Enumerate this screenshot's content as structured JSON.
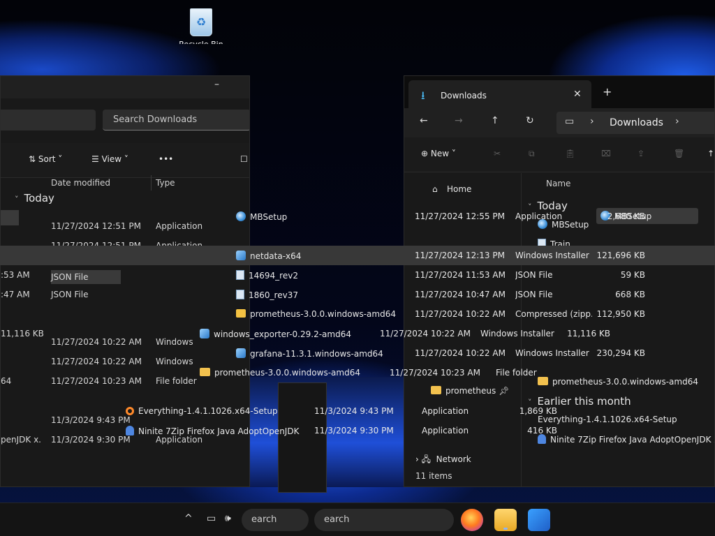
{
  "desktop": {
    "recycle_bin_label": "Recycle Bin"
  },
  "left_window": {
    "search_placeholder": "Search Downloads",
    "toolbar": {
      "sort": "Sort",
      "view": "View",
      "more": "•••"
    },
    "columns": {
      "date": "Date modified",
      "type": "Type"
    },
    "group_today": "Today",
    "rows": [
      {
        "date": "11/27/2024 12:51 PM",
        "type": "Application"
      },
      {
        "date": "11/27/2024 12:51 PM",
        "type": "Application"
      },
      {
        "date": "11/27/2024 12:13 PM",
        "type": "Windows Insta"
      },
      {
        "date": "11/27/2024 11:53 AM",
        "type": "JSON File"
      },
      {
        "date": "11/27/2024 10:47 AM",
        "type": "JSON File"
      },
      {
        "date": "11/27/2024 10:22 AM",
        "type": "Compress"
      },
      {
        "date": "11/27/2024 10:22 AM",
        "type": "Windows"
      },
      {
        "date": "11/27/2024 10:22 AM",
        "type": "Windows"
      },
      {
        "date": "11/27/2024 10:23 AM",
        "type": "File folder"
      },
      {
        "date": "11/3/2024 9:43 PM",
        "type": "Application"
      },
      {
        "date": "11/3/2024 9:30 PM",
        "type": "Application"
      }
    ],
    "fragments": {
      "mbsetup": "MBSetup",
      "windows_amd64": "0.windows-amd64",
      "size_11116": "11,116 KB",
      "suffix_64": "64",
      "openjdk": "penJDK x.",
      "time_53": ":53 AM",
      "time_47": ":47 AM"
    }
  },
  "right_window": {
    "tab_title": "Downloads",
    "address": "Downloads",
    "toolbar": {
      "new": "New"
    },
    "nav_pane": {
      "home": "Home",
      "prometheus": "prometheus",
      "network": "Network"
    },
    "columns": {
      "name": "Name"
    },
    "group_today": "Today",
    "group_earlier": "Earlier this month",
    "preview_rows": [
      "MBSetup",
      "MBSetup",
      "Train",
      "prometheus-3.0.0.windows-amd64",
      "Everything-1.4.1.1026.x64-Setup",
      "Ninite 7Zip Firefox Java AdoptOpenJDK x."
    ],
    "status": "11 items"
  },
  "files": [
    {
      "name": "MBSetup",
      "date": "11/27/2024 12:55 PM",
      "type": "Application",
      "size": "2,680 KB",
      "icon": "app",
      "selected": false
    },
    {
      "name": "netdata-x64",
      "date": "11/27/2024 12:13 PM",
      "type": "Windows Installer ...",
      "size": "121,696 KB",
      "icon": "msi",
      "selected": true
    },
    {
      "name": "14694_rev2",
      "date": "11/27/2024 11:53 AM",
      "type": "JSON File",
      "size": "59 KB",
      "icon": "json",
      "selected": false
    },
    {
      "name": "1860_rev37",
      "date": "11/27/2024 10:47 AM",
      "type": "JSON File",
      "size": "668 KB",
      "icon": "json",
      "selected": false
    },
    {
      "name": "prometheus-3.0.0.windows-amd64",
      "date": "11/27/2024 10:22 AM",
      "type": "Compressed (zipp...",
      "size": "112,950 KB",
      "icon": "zip",
      "selected": false
    },
    {
      "name": "windows_exporter-0.29.2-amd64",
      "date": "11/27/2024 10:22 AM",
      "type": "Windows Installer ...",
      "size": "11,116 KB",
      "icon": "msi",
      "selected": false
    },
    {
      "name": "grafana-11.3.1.windows-amd64",
      "date": "11/27/2024 10:22 AM",
      "type": "Windows Installer ...",
      "size": "230,294 KB",
      "icon": "msi",
      "selected": false
    },
    {
      "name": "prometheus-3.0.0.windows-amd64",
      "date": "11/27/2024 10:23 AM",
      "type": "File folder",
      "size": "",
      "icon": "folder",
      "selected": false
    },
    {
      "name": "Everything-1.4.1.1026.x64-Setup",
      "date": "11/3/2024 9:43 PM",
      "type": "Application",
      "size": "1,869 KB",
      "icon": "everything",
      "selected": false
    },
    {
      "name": "Ninite 7Zip Firefox Java AdoptOpenJDK x...",
      "date": "11/3/2024 9:30 PM",
      "type": "Application",
      "size": "416 KB",
      "icon": "ninite",
      "selected": false
    }
  ],
  "taskbar": {
    "search_left": "earch",
    "search_right": "earch"
  },
  "colors": {
    "accent": "#4cc2ff",
    "window_bg": "#191919",
    "selection": "#383838",
    "folder": "#f2c14e"
  }
}
